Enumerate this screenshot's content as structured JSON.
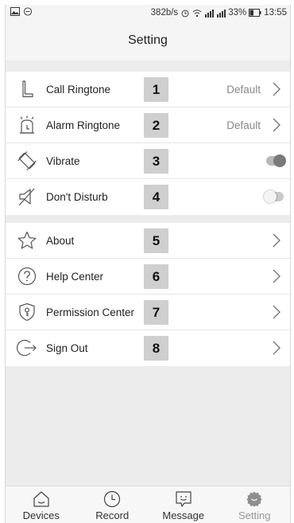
{
  "status_bar": {
    "network_speed": "382b/s",
    "battery": "33%",
    "time": "13:55"
  },
  "header": {
    "title": "Setting"
  },
  "settings_group_1": [
    {
      "label": "Call Ringtone",
      "marker": "1",
      "value": "Default",
      "icon": "phone-handset-icon"
    },
    {
      "label": "Alarm Ringtone",
      "marker": "2",
      "value": "Default",
      "icon": "alarm-icon"
    },
    {
      "label": "Vibrate",
      "marker": "3",
      "toggle": "on",
      "icon": "vibrate-icon"
    },
    {
      "label": "Don't Disturb",
      "marker": "4",
      "toggle": "off",
      "icon": "mute-icon"
    }
  ],
  "settings_group_2": [
    {
      "label": "About",
      "marker": "5",
      "icon": "star-icon"
    },
    {
      "label": "Help Center",
      "marker": "6",
      "icon": "question-icon"
    },
    {
      "label": "Permission Center",
      "marker": "7",
      "icon": "shield-key-icon"
    },
    {
      "label": "Sign Out",
      "marker": "8",
      "icon": "sign-out-icon"
    }
  ],
  "tab_bar": [
    {
      "label": "Devices",
      "icon": "home-icon",
      "active": false
    },
    {
      "label": "Record",
      "icon": "clock-icon",
      "active": false
    },
    {
      "label": "Message",
      "icon": "message-icon",
      "active": false
    },
    {
      "label": "Setting",
      "icon": "gear-icon",
      "active": true
    }
  ],
  "colors": {
    "background": "#ececec",
    "marker_box": "#cfcfcf",
    "muted_text": "#888888",
    "active_tab": "#999999"
  }
}
